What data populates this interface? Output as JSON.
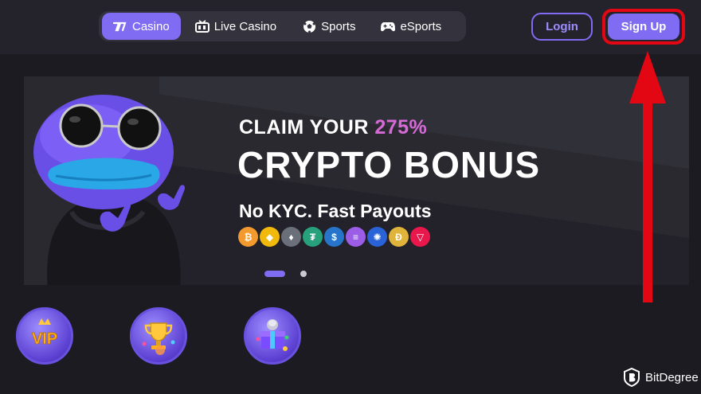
{
  "nav": {
    "tabs": [
      {
        "label": "Casino",
        "icon": "casino-icon",
        "active": true
      },
      {
        "label": "Live Casino",
        "icon": "live-casino-icon",
        "active": false
      },
      {
        "label": "Sports",
        "icon": "soccer-ball-icon",
        "active": false
      },
      {
        "label": "eSports",
        "icon": "gamepad-icon",
        "active": false
      }
    ],
    "login_label": "Login",
    "signup_label": "Sign Up"
  },
  "hero": {
    "line1_prefix": "CLAIM YOUR ",
    "line1_accent": "275%",
    "line2": "CRYPTO BONUS",
    "line3": "No KYC. Fast Payouts",
    "coins": [
      {
        "name": "bitcoin",
        "glyph": "₿",
        "color": "#f29a2e"
      },
      {
        "name": "bnb",
        "glyph": "◆",
        "color": "#f0b90b"
      },
      {
        "name": "ethereum",
        "glyph": "♦",
        "color": "#6b6f7a"
      },
      {
        "name": "tether",
        "glyph": "₮",
        "color": "#26a17b"
      },
      {
        "name": "usd-coin",
        "glyph": "$",
        "color": "#2775ca"
      },
      {
        "name": "solana",
        "glyph": "≡",
        "color": "#9b5ce6"
      },
      {
        "name": "cardano",
        "glyph": "✺",
        "color": "#2a62d8"
      },
      {
        "name": "dogecoin",
        "glyph": "Ð",
        "color": "#e0b33a"
      },
      {
        "name": "tron",
        "glyph": "▽",
        "color": "#e8174c"
      }
    ],
    "slides_total": 2,
    "slide_active": 1
  },
  "categories": [
    {
      "label": "VIP",
      "icon": "vip-crown-icon"
    },
    {
      "icon": "trophy-icon"
    },
    {
      "icon": "gift-box-icon"
    }
  ],
  "annotation": {
    "highlight_color": "#e30613"
  },
  "watermark": {
    "label": "BitDegree"
  },
  "colors": {
    "accent": "#7f6cf2",
    "background": "#1c1b21",
    "topbar": "#24232b",
    "highlight_pink": "#d66ad6"
  }
}
